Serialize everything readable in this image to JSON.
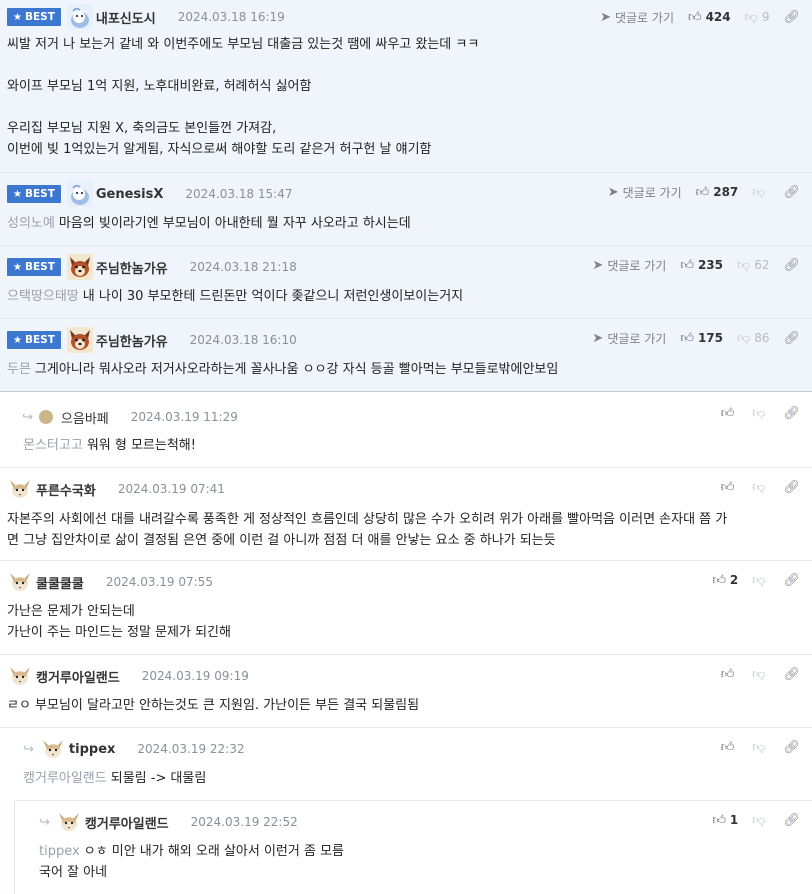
{
  "labels": {
    "best": "BEST",
    "goto": "댓글로 가기"
  },
  "icons": {
    "thumbs_up": "thumbs-up-icon",
    "thumbs_down": "thumbs-down-icon",
    "link": "link-icon",
    "star": "star-icon",
    "reply": "reply-arrow-icon",
    "goto": "send-arrow-icon"
  },
  "colors": {
    "best_badge": "#3c78d0",
    "best_row_bg": "#f0f4fb",
    "mention": "#9aa0ab",
    "date": "#8a8f99"
  },
  "comments": [
    {
      "nickname": "내포신도시",
      "date": "2024.03.18 16:19",
      "up": "424",
      "down": "9",
      "lines": [
        "씨발 저거 나 보는거 같네 와 이번주에도 부모님 대출금 있는것 땜에 싸우고 왔는데 ㅋㅋ",
        "와이프 부모님 1억 지원, 노후대비완료, 허례허식 싫어함",
        "우리집 부모님 지원 X, 축의금도 본인들껀 가져감,",
        "이번에 빚 1억있는거 알게됨, 자식으로써 해야할 도리 같은거 허구헌 날 얘기함"
      ]
    },
    {
      "nickname": "GenesisX",
      "date": "2024.03.18 15:47",
      "up": "287",
      "mention": "성의노예",
      "lines": [
        "마음의 빚이라기엔 부모님이 아내한테 뭘 자꾸 사오라고 하시는데"
      ]
    },
    {
      "nickname": "주님한놈가유",
      "date": "2024.03.18 21:18",
      "up": "235",
      "down": "62",
      "mention": "으택땅으태땅",
      "lines": [
        "내 나이 30 부모한테 드린돈만 억이다 좆같으니 저런인생이보이는거지"
      ]
    },
    {
      "nickname": "주님한놈가유",
      "date": "2024.03.18 16:10",
      "up": "175",
      "down": "86",
      "mention": "두믄",
      "lines": [
        "그게아니라 뭐사오라 저거사오라하는게 꼴사나움 ㅇㅇ강 자식 등골 빨아먹는 부모들로밖에안보임"
      ]
    },
    {
      "nickname": "으음바페",
      "date": "2024.03.19 11:29",
      "mention": "몬스터고고",
      "lines": [
        "워워 형 모르는척해!"
      ]
    },
    {
      "nickname": "푸른수국화",
      "date": "2024.03.19 07:41",
      "lines": [
        "자본주의 사회에선 대를 내려갈수록 풍족한 게 정상적인 흐름인데 상당히 많은 수가 오히려 위가 아래를 빨아먹음 이러면 손자대 쯤 가",
        "면 그냥 집안차이로 삶이 결정됨 은연 중에 이런 걸 아니까 점점 더 애를 안낳는 요소 중 하나가 되는듯"
      ]
    },
    {
      "nickname": "쿨쿨쿨쿨",
      "date": "2024.03.19 07:55",
      "up": "2",
      "lines": [
        "가난은 문제가 안되는데",
        "가난이 주는 마인드는 정말 문제가 되긴해"
      ]
    },
    {
      "nickname": "캥거루아일랜드",
      "date": "2024.03.19 09:19",
      "lines": [
        "ㄹㅇ 부모님이 달라고만 안하는것도 큰 지원임. 가난이든 부든 결국 되물림됨"
      ]
    },
    {
      "nickname": "tippex",
      "date": "2024.03.19 22:32",
      "mention": "캥거루아일랜드",
      "lines": [
        "되물림 -> 대물림"
      ]
    },
    {
      "nickname": "캥거루아일랜드",
      "date": "2024.03.19 22:52",
      "up": "1",
      "mention": "tippex",
      "lines": [
        "ㅇㅎ 미안 내가 해외 오래 살아서 이런거 좀 모름",
        "국어 잘 아네"
      ]
    }
  ]
}
